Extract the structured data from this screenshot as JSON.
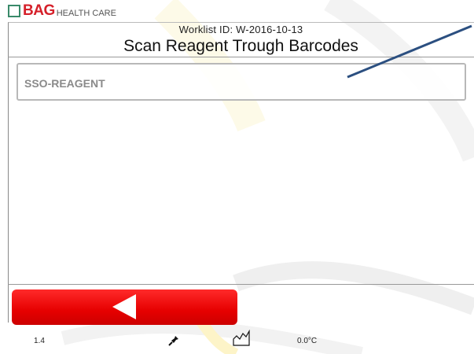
{
  "brand": {
    "name": "BAG",
    "subtitle": "HEALTH CARE"
  },
  "header": {
    "worklist": "Worklist ID: W-2016-10-13",
    "title": "Scan Reagent Trough Barcodes"
  },
  "reagent_field": {
    "label": "SSO-REAGENT"
  },
  "status": {
    "version": "1.4",
    "temperature": "0.0°C"
  },
  "colors": {
    "accent_red": "#e60000",
    "brand_green": "#3a8a6a"
  }
}
